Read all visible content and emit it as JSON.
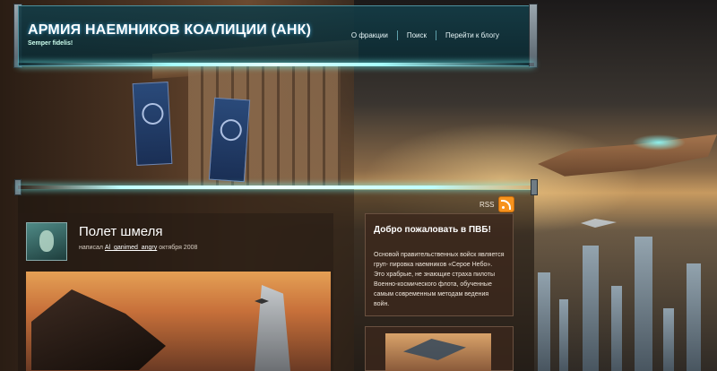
{
  "header": {
    "site_title": "АРМИЯ НАЕМНИКОВ КОАЛИЦИИ (АНК)",
    "tagline": "Semper fidelis!",
    "nav": [
      {
        "label": "О фракции"
      },
      {
        "label": "Поиск"
      },
      {
        "label": "Перейти к блогу"
      }
    ]
  },
  "feed": {
    "label": "RSS",
    "icon": "rss-icon"
  },
  "post": {
    "title": "Полет шмеля",
    "meta_prefix": "написал",
    "author": "Al_ganimed_angry",
    "date": "октября 2008"
  },
  "sidebar": {
    "welcome_title": "Добро пожаловать в ПВБ!",
    "welcome_text": "Основой правительственных войск является груп- пировка наемников «Серое Небо». Это храбрые, не знающие страха пилоты Военно-космического флота, обученные самым современным методам ведения войн."
  },
  "colors": {
    "header_bg": "#0f3a44",
    "accent_glow": "#a8ffff",
    "rss_orange": "#f7931e",
    "panel_bg": "#1e1610"
  }
}
